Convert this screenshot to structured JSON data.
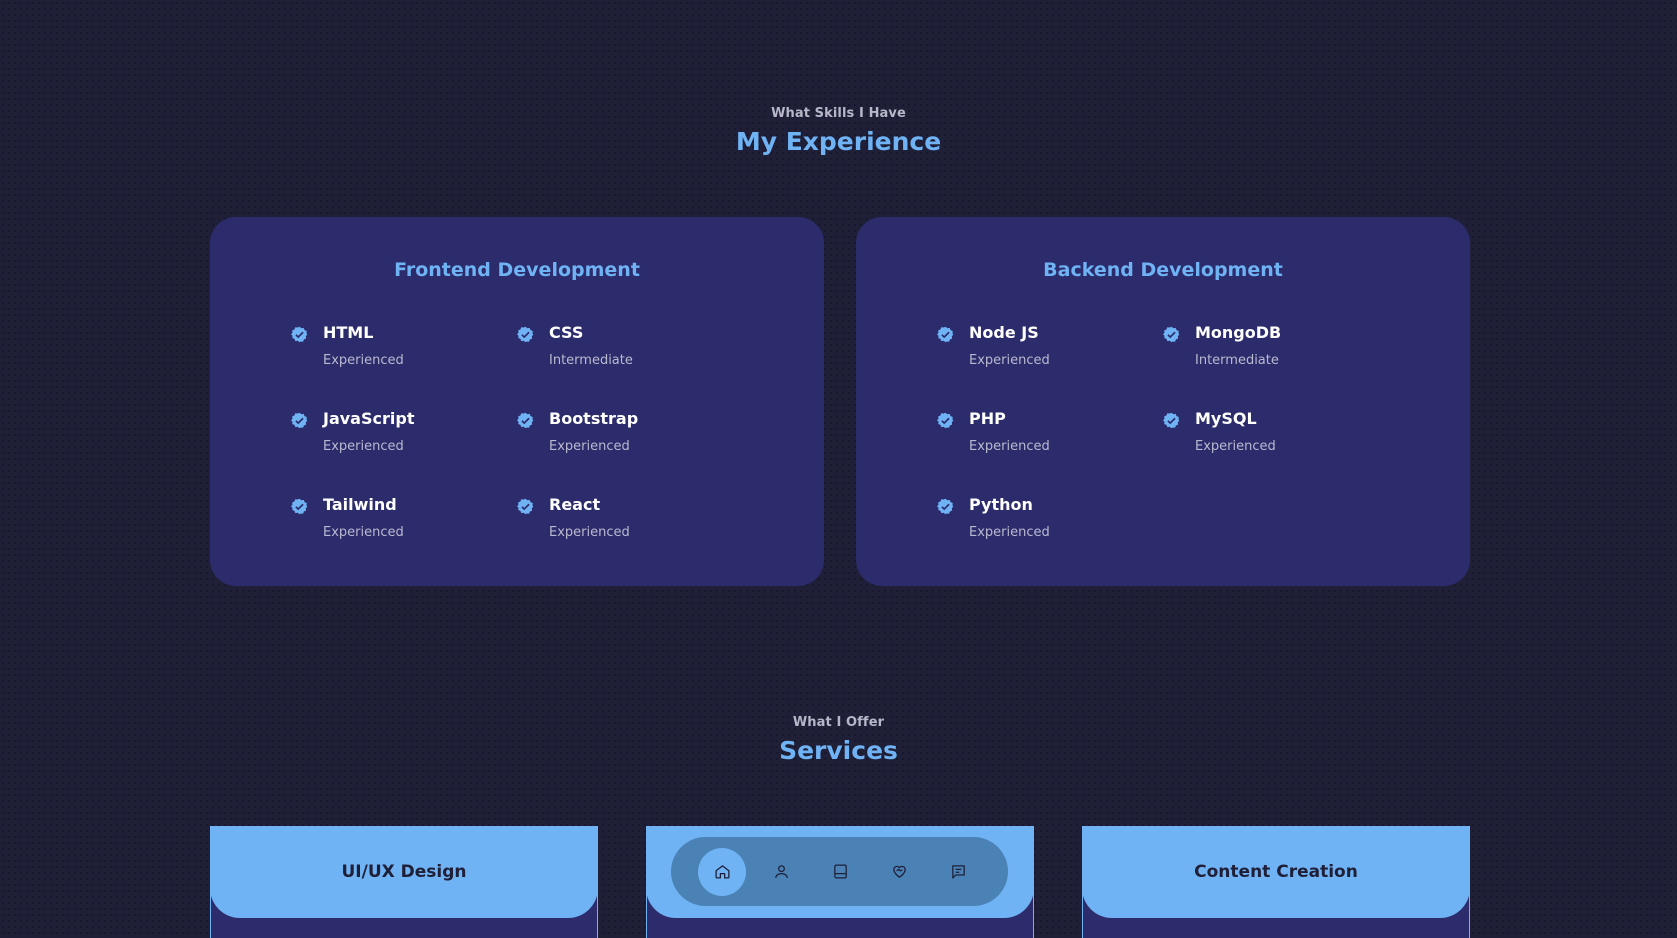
{
  "experience": {
    "subtitle": "What Skills I Have",
    "title": "My Experience",
    "frontend": {
      "title": "Frontend Development",
      "skills": [
        {
          "name": "HTML",
          "level": "Experienced"
        },
        {
          "name": "CSS",
          "level": "Intermediate"
        },
        {
          "name": "JavaScript",
          "level": "Experienced"
        },
        {
          "name": "Bootstrap",
          "level": "Experienced"
        },
        {
          "name": "Tailwind",
          "level": "Experienced"
        },
        {
          "name": "React",
          "level": "Experienced"
        }
      ]
    },
    "backend": {
      "title": "Backend Development",
      "skills": [
        {
          "name": "Node JS",
          "level": "Experienced"
        },
        {
          "name": "MongoDB",
          "level": "Intermediate"
        },
        {
          "name": "PHP",
          "level": "Experienced"
        },
        {
          "name": "MySQL",
          "level": "Experienced"
        },
        {
          "name": "Python",
          "level": "Experienced"
        }
      ]
    }
  },
  "services": {
    "subtitle": "What I Offer",
    "title": "Services",
    "items": [
      {
        "title": "UI/UX Design"
      },
      {
        "title": "Content Creation"
      }
    ]
  },
  "nav": {
    "items": [
      {
        "icon": "home-icon",
        "active": true
      },
      {
        "icon": "user-icon",
        "active": false
      },
      {
        "icon": "book-icon",
        "active": false
      },
      {
        "icon": "heart-handshake-icon",
        "active": false
      },
      {
        "icon": "message-icon",
        "active": false
      }
    ]
  },
  "colors": {
    "background": "#1f1f38",
    "card": "#2c2c6c",
    "accent": "#6fb3f5",
    "nav_bg": "#4a82b5"
  }
}
